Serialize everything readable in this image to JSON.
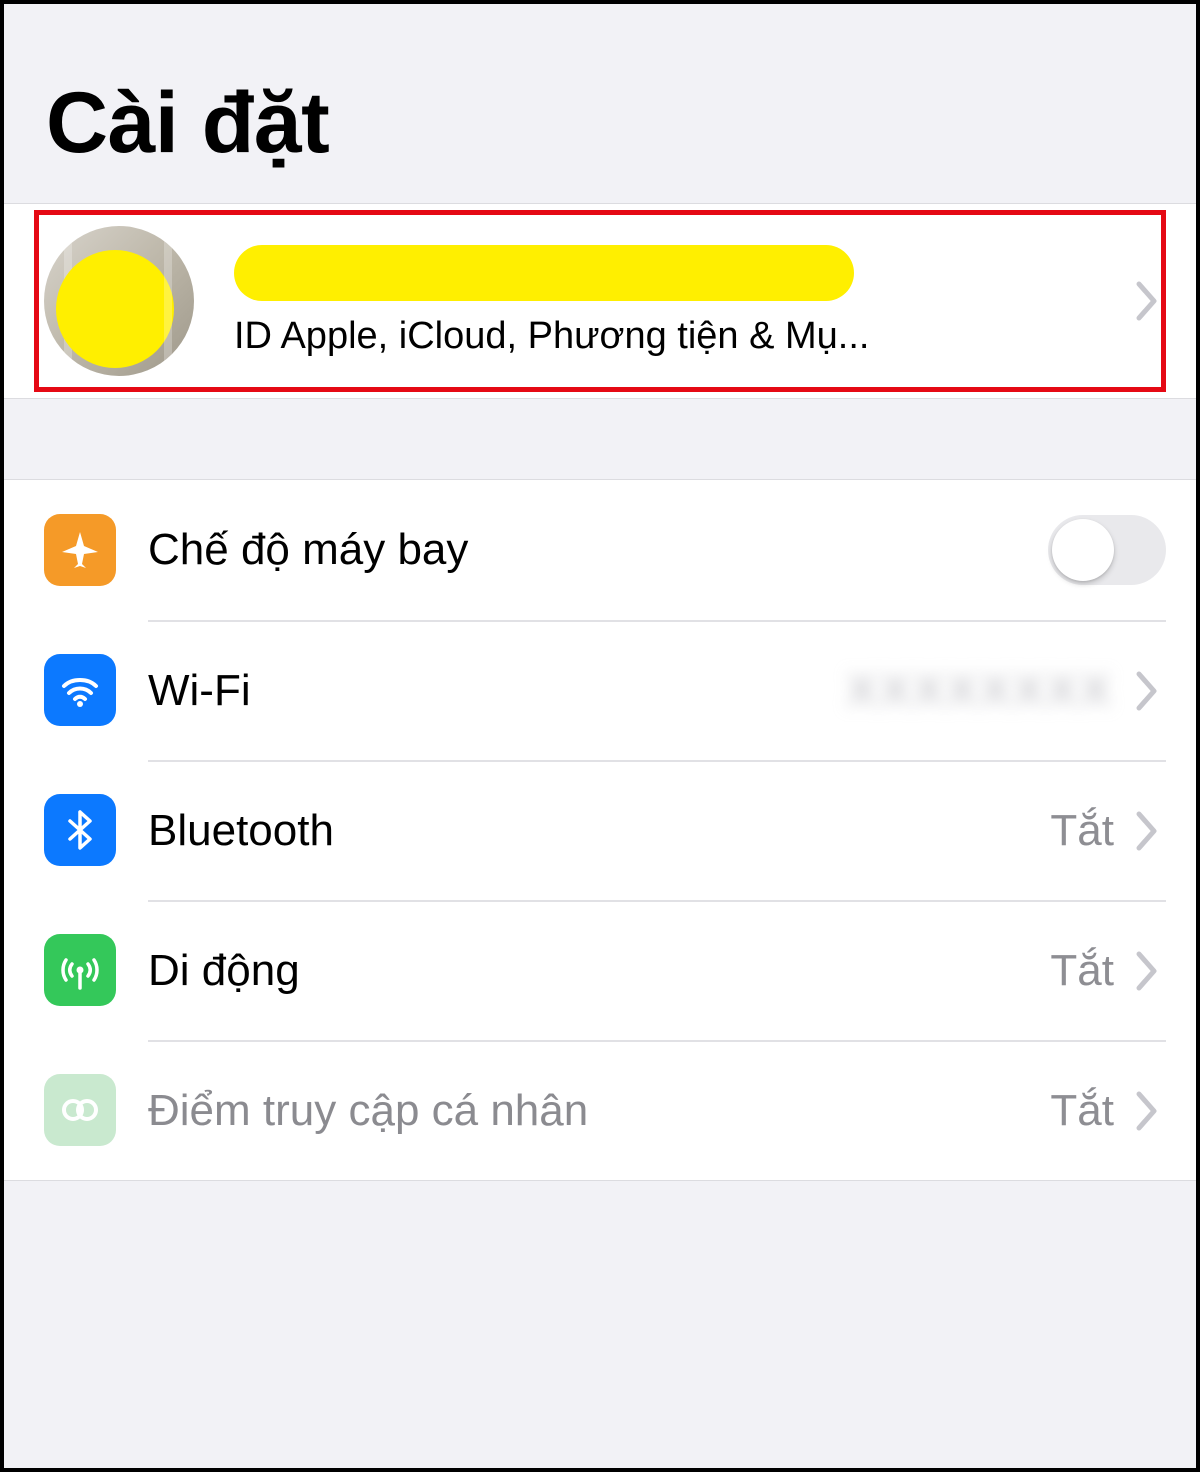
{
  "header": {
    "title": "Cài đặt"
  },
  "profile": {
    "name_redacted": true,
    "subtitle": "ID Apple, iCloud, Phương tiện & Mụ..."
  },
  "rows": {
    "airplane": {
      "label": "Chế độ máy bay",
      "toggle": "off"
    },
    "wifi": {
      "label": "Wi-Fi",
      "value": ""
    },
    "bluetooth": {
      "label": "Bluetooth",
      "value": "Tắt"
    },
    "cellular": {
      "label": "Di động",
      "value": "Tắt"
    },
    "hotspot": {
      "label": "Điểm truy cập cá nhân",
      "value": "Tắt"
    }
  },
  "colors": {
    "highlight_border": "#e50914",
    "redaction": "#ffef00"
  }
}
